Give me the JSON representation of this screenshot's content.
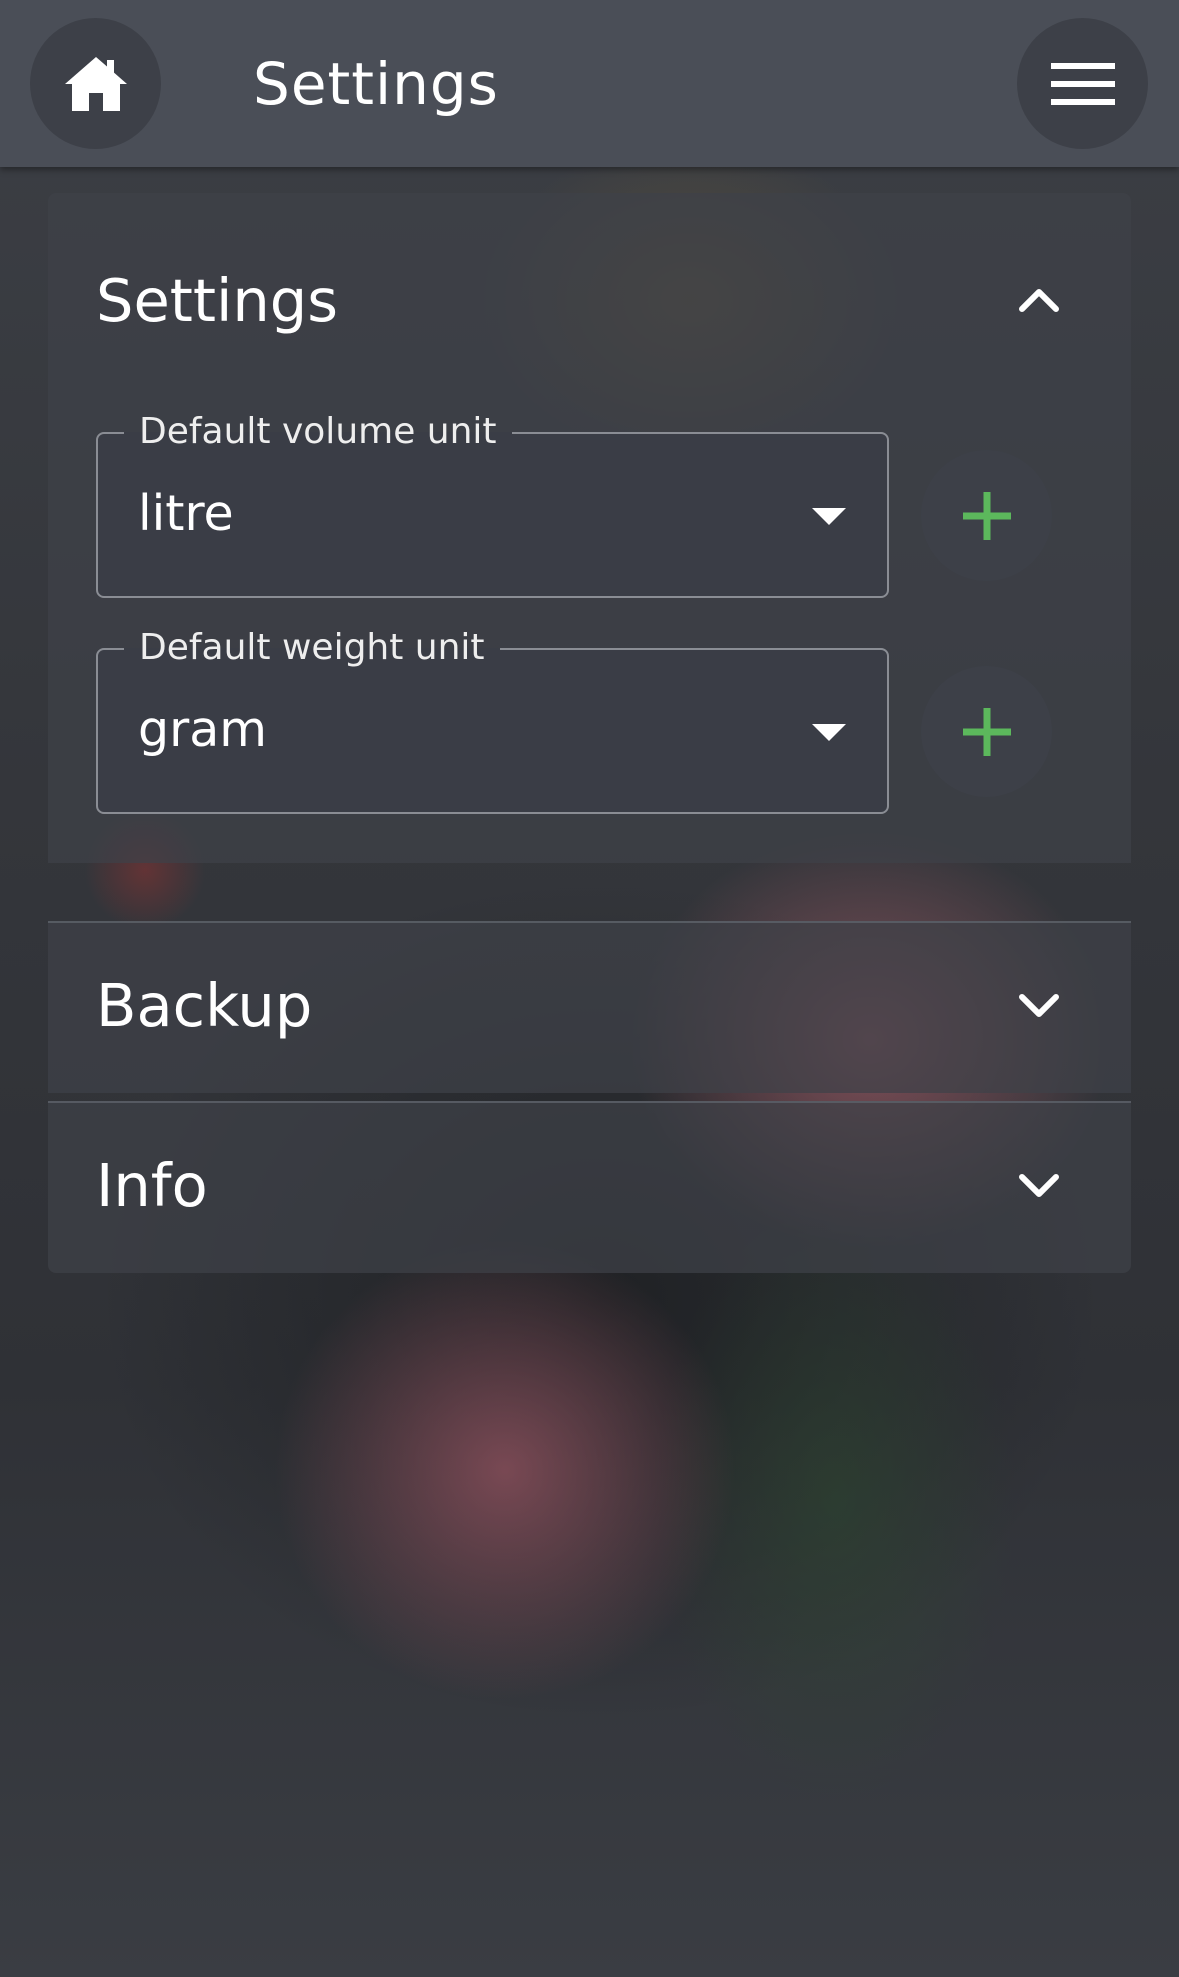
{
  "appbar": {
    "title": "Settings",
    "home_icon": "home-icon",
    "menu_icon": "hamburger-menu-icon"
  },
  "panels": {
    "settings": {
      "title": "Settings",
      "expanded": true,
      "fields": [
        {
          "label": "Default volume unit",
          "value": "litre"
        },
        {
          "label": "Default weight unit",
          "value": "gram"
        }
      ],
      "add_icon": "plus-icon"
    },
    "backup": {
      "title": "Backup",
      "expanded": false
    },
    "info": {
      "title": "Info",
      "expanded": false
    }
  },
  "colors": {
    "appbar": "#4a4e57",
    "accent_green": "#5cb85c",
    "text": "#ffffff"
  }
}
